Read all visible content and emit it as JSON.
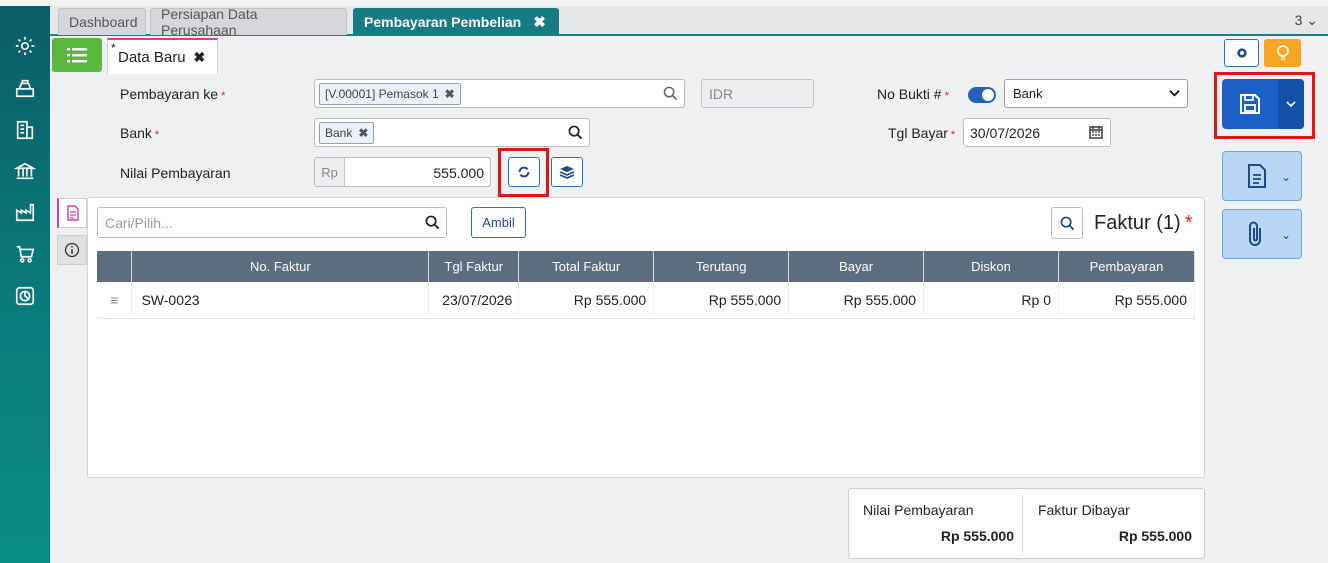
{
  "tabs": [
    {
      "label": "Dashboard"
    },
    {
      "label": "Persiapan Data Perusahaan"
    },
    {
      "label": "Pembayaran Pembelian"
    }
  ],
  "tab_count": "3",
  "subtab": {
    "marker": "*",
    "label": "Data Baru"
  },
  "form": {
    "pembayaran_ke_label": "Pembayaran ke",
    "pembayaran_ke_value": "[V.00001] Pemasok 1",
    "currency": "IDR",
    "bank_label": "Bank",
    "bank_value": "Bank",
    "nilai_label": "Nilai Pembayaran",
    "nilai_prefix": "Rp",
    "nilai_value": "555.000",
    "no_bukti_label": "No Bukti #",
    "no_bukti_select": "Bank",
    "tgl_bayar_label": "Tgl Bayar",
    "tgl_bayar_value": "30/07/2026",
    "required_mark": "*"
  },
  "panel": {
    "search_placeholder": "Cari/Pilih...",
    "ambil_label": "Ambil",
    "title": "Faktur (1)",
    "columns": [
      "No. Faktur",
      "Tgl Faktur",
      "Total Faktur",
      "Terutang",
      "Bayar",
      "Diskon",
      "Pembayaran"
    ],
    "rows": [
      {
        "no": "SW-0023",
        "tgl": "23/07/2026",
        "total": "Rp 555.000",
        "terutang": "Rp 555.000",
        "bayar": "Rp 555.000",
        "diskon": "Rp 0",
        "pembayaran": "Rp 555.000"
      }
    ]
  },
  "summary": {
    "nilai_label": "Nilai Pembayaran",
    "nilai_value": "Rp 555.000",
    "faktur_label": "Faktur Dibayar",
    "faktur_value": "Rp 555.000"
  },
  "colors": {
    "accent": "#167c83",
    "primary": "#1c5fc7",
    "highlight": "#e1141c",
    "warning": "#f6a623"
  },
  "icons": [
    "gear-icon",
    "cash-register-icon",
    "building-icon",
    "bank-icon",
    "factory-icon",
    "cart-icon",
    "chart-icon",
    "list-icon",
    "save-icon",
    "document-icon",
    "paperclip-icon",
    "bulb-icon",
    "refresh-icon",
    "layers-icon",
    "search-icon",
    "calendar-icon",
    "info-icon",
    "file-icon"
  ]
}
